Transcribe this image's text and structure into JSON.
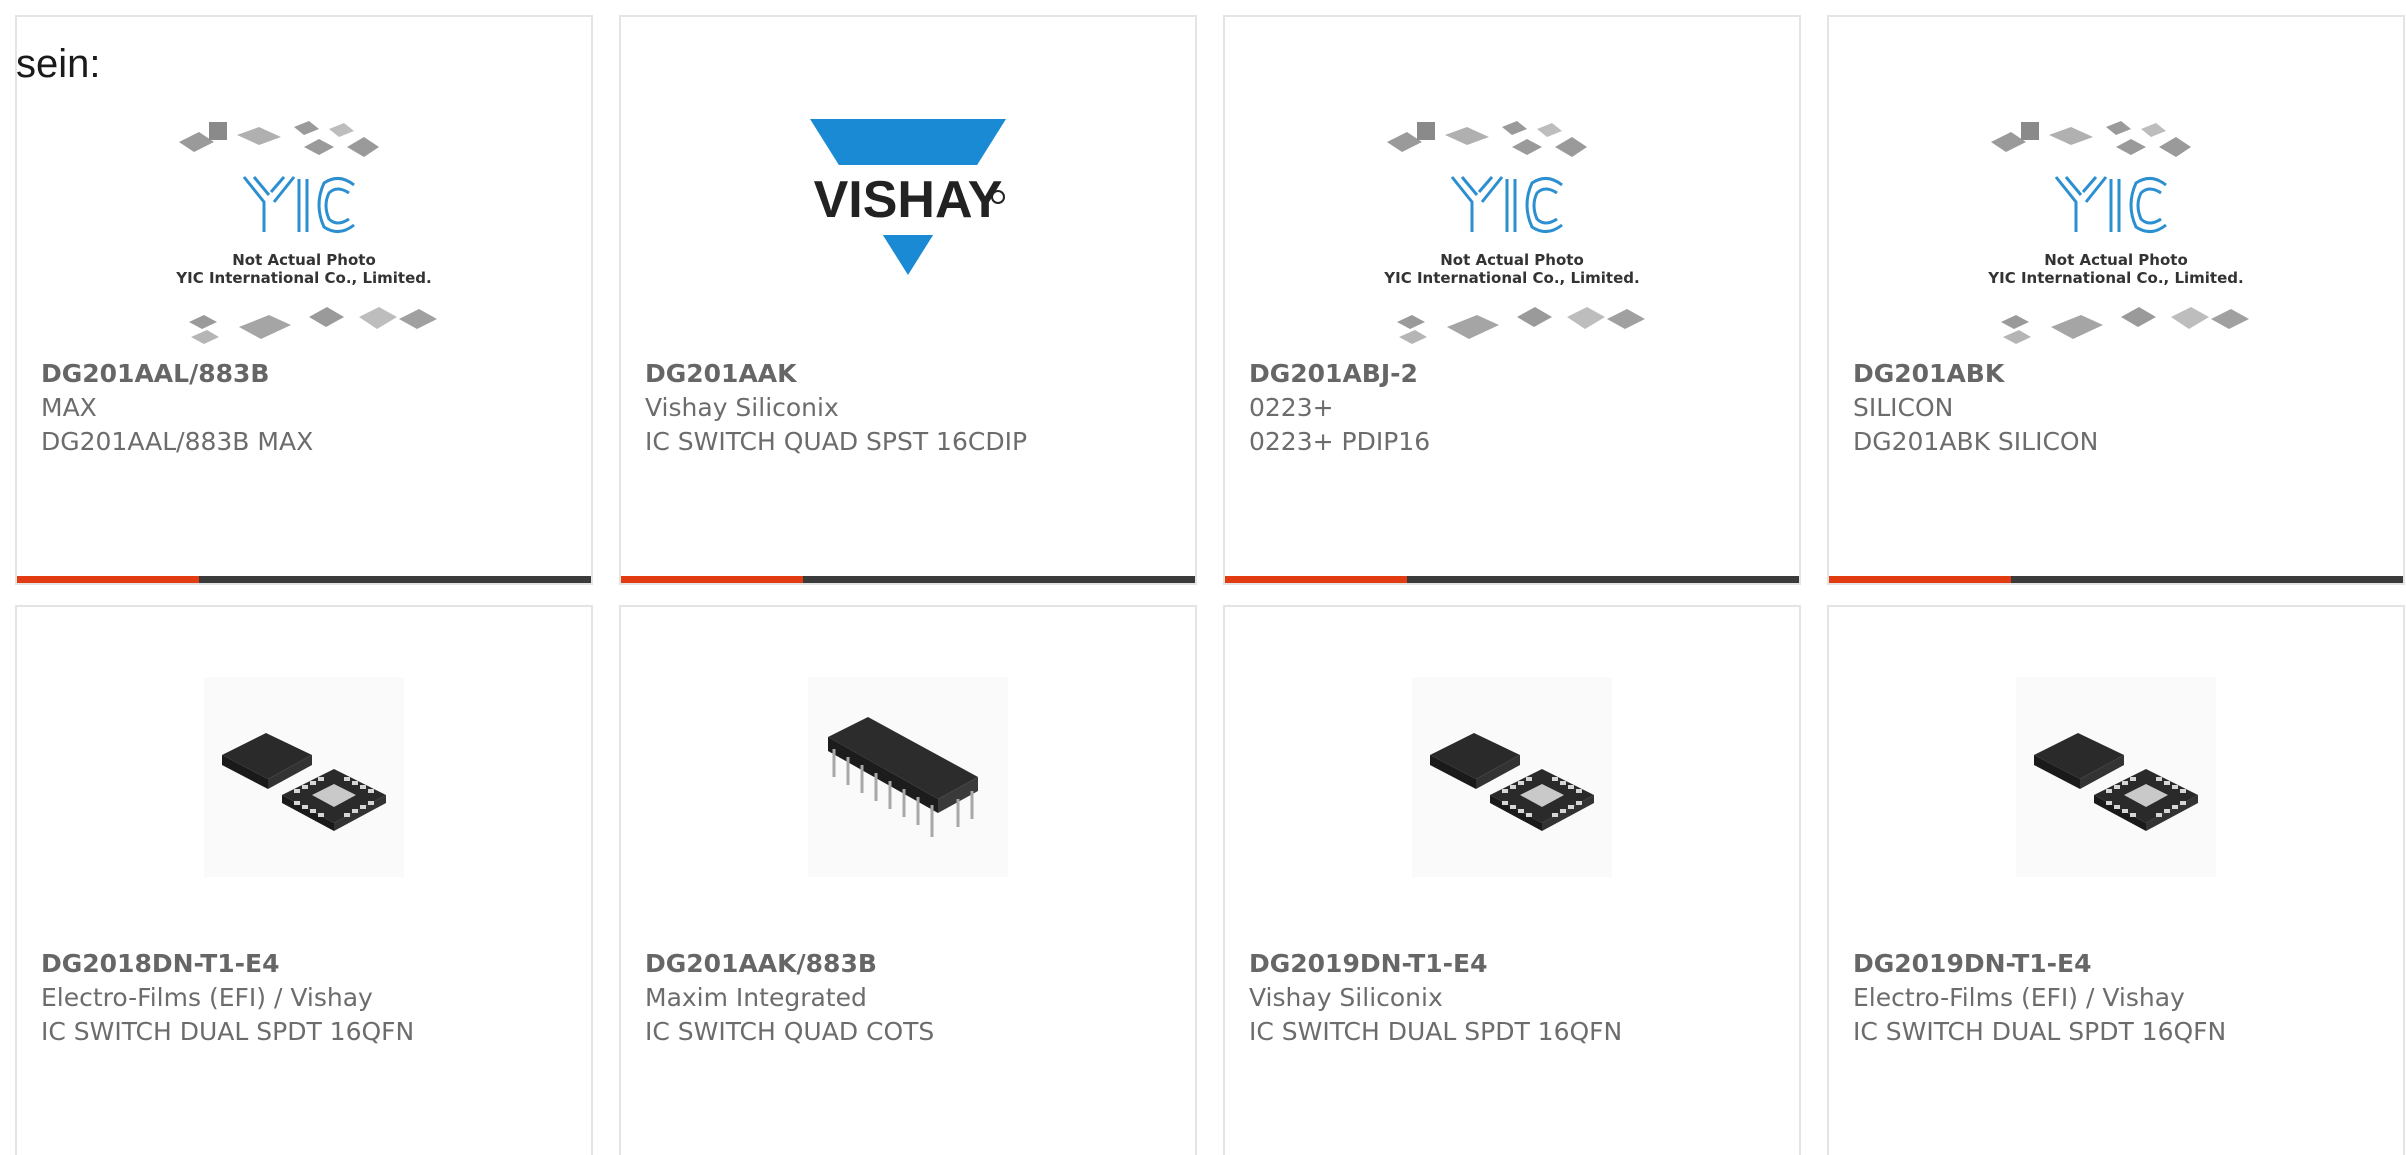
{
  "intro": "sein:",
  "placeholder": {
    "line1": "Not Actual Photo",
    "line2": "YIC International Co., Limited."
  },
  "brand": {
    "vishay_logo_text": "VISHAY",
    "accent": "#e23b11",
    "bar": "#3a3a3a",
    "vishay_blue": "#1a8ad4"
  },
  "cards": [
    {
      "part": "DG201AAL/883B",
      "mfr": "MAX",
      "desc": "DG201AAL/883B MAX",
      "image": "yic-placeholder-image"
    },
    {
      "part": "DG201AAK",
      "mfr": "Vishay Siliconix",
      "desc": "IC SWITCH QUAD SPST 16CDIP",
      "image": "vishay-logo"
    },
    {
      "part": "DG201ABJ-2",
      "mfr": "0223+",
      "desc": "0223+ PDIP16",
      "image": "yic-placeholder-image"
    },
    {
      "part": "DG201ABK",
      "mfr": "SILICON",
      "desc": "DG201ABK SILICON",
      "image": "yic-placeholder-image"
    },
    {
      "part": "DG2018DN-T1-E4",
      "mfr": "Electro-Films (EFI) / Vishay",
      "desc": "IC SWITCH DUAL SPDT 16QFN",
      "image": "qfn-chip-image"
    },
    {
      "part": "DG201AAK/883B",
      "mfr": "Maxim Integrated",
      "desc": "IC SWITCH QUAD COTS",
      "image": "dip-chip-image"
    },
    {
      "part": "DG2019DN-T1-E4",
      "mfr": "Vishay Siliconix",
      "desc": "IC SWITCH DUAL SPDT 16QFN",
      "image": "qfn-chip-image"
    },
    {
      "part": "DG2019DN-T1-E4",
      "mfr": "Electro-Films (EFI) / Vishay",
      "desc": "IC SWITCH DUAL SPDT 16QFN",
      "image": "qfn-chip-image"
    }
  ]
}
